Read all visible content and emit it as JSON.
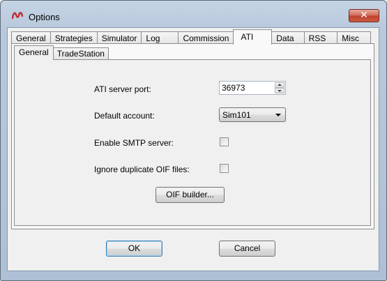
{
  "window": {
    "title": "Options",
    "close_glyph": "✕",
    "icon": "ninjatrader-logo-icon"
  },
  "tabs": [
    "General",
    "Strategies",
    "Simulator",
    "Log",
    "Commission",
    "ATI",
    "Data",
    "RSS",
    "Misc"
  ],
  "active_tab": "ATI",
  "subtabs": [
    "General",
    "TradeStation"
  ],
  "active_subtab": "General",
  "form": {
    "port_label": "ATI server port:",
    "port_value": "36973",
    "account_label": "Default account:",
    "account_value": "Sim101",
    "smtp_label": "Enable SMTP server:",
    "smtp_checked": false,
    "oif_label": "Ignore duplicate OIF files:",
    "oif_checked": false,
    "oif_builder_button": "OIF builder..."
  },
  "footer": {
    "ok_label": "OK",
    "cancel_label": "Cancel"
  }
}
